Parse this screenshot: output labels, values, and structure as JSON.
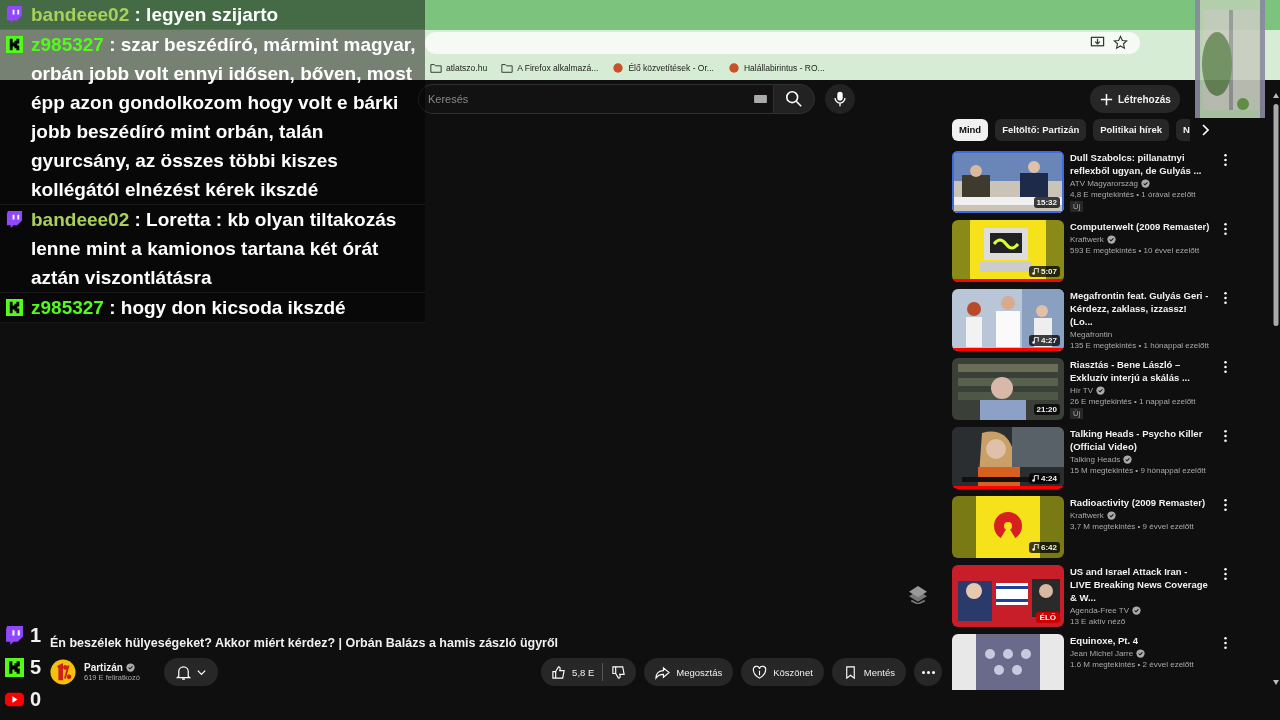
{
  "browser": {
    "bookmarks": [
      {
        "label": "atlatszo.hu",
        "kind": "folder"
      },
      {
        "label": "A Firefox alkalmazá...",
        "kind": "folder"
      },
      {
        "label": "Élő közvetítések - Or...",
        "kind": "site"
      },
      {
        "label": "Halállabirintus - RO...",
        "kind": "site"
      }
    ]
  },
  "topbar": {
    "search": {
      "placeholder": "Keresés"
    },
    "create_button": "Létrehozás"
  },
  "chips": [
    {
      "label": "Mind",
      "selected": true
    },
    {
      "label": "Feltöltő: Partizán",
      "selected": false
    },
    {
      "label": "Politikai hírek",
      "selected": false
    },
    {
      "label": "N",
      "selected": false
    }
  ],
  "video": {
    "title": "Én beszélek hülyeségeket? Akkor miért kérdez? | Orbán Balázs a hamis zászló ügyről",
    "channel": "Partizán",
    "verified": true,
    "subscribers": "619 E feliratkozó",
    "likes": "5,8 E",
    "share": "Megosztás",
    "thanks": "Köszönet",
    "save": "Mentés"
  },
  "recommendations": [
    {
      "title": "Dull Szabolcs: pillanatnyi reflexből ugyan, de Gulyás ...",
      "channel": "ATV Magyarország",
      "verified": true,
      "meta": "4,8 E megtekintés • 1 órával ezelőtt",
      "badge": "Új",
      "duration": "15:32",
      "music": false,
      "watched": false,
      "focused": true
    },
    {
      "title": "Computerwelt (2009 Remaster)",
      "channel": "Kraftwerk",
      "verified": true,
      "meta": "593 E megtekintés • 10 évvel ezelőtt",
      "duration": "5:07",
      "music": true,
      "watched": true,
      "focused": false
    },
    {
      "title": "Megafrontin feat. Gulyás Geri - Kérdezz, zaklass, izzassz! (Lo...",
      "channel": "Megafrontin",
      "verified": false,
      "meta": "135 E megtekintés • 1 hónappal ezelőtt",
      "duration": "4:27",
      "music": true,
      "watched": true,
      "focused": false
    },
    {
      "title": "Riasztás - Bene László – Exkluzív interjú a skálás ...",
      "channel": "Hír TV",
      "verified": true,
      "meta": "26 E megtekintés • 1 nappal ezelőtt",
      "badge": "Új",
      "duration": "21:20",
      "music": false,
      "watched": false,
      "focused": false
    },
    {
      "title": "Talking Heads - Psycho Killer (Official Video)",
      "channel": "Talking Heads",
      "verified": true,
      "meta": "15 M megtekintés • 9 hónappal ezelőtt",
      "duration": "4:24",
      "music": true,
      "watched": true,
      "focused": false
    },
    {
      "title": "Radioactivity (2009 Remaster)",
      "channel": "Kraftwerk",
      "verified": true,
      "meta": "3,7 M megtekintés • 9 évvel ezelőtt",
      "duration": "6:42",
      "music": true,
      "watched": false,
      "focused": false
    },
    {
      "title": "US and Israel Attack Iran - LIVE Breaking News Coverage & W...",
      "channel": "Agenda-Free TV",
      "verified": true,
      "meta": "13 E aktív néző",
      "live": "ÉLŐ",
      "watched": false,
      "focused": false
    },
    {
      "title": "Equinoxe, Pt. 4",
      "channel": "Jean Michel Jarre",
      "verified": true,
      "meta": "1.6 M megtekintés • 2 évvel ezelőtt",
      "focused": false
    }
  ],
  "chat": [
    {
      "kind": "twitch",
      "user": "bandeee02",
      "text": ": legyen szijarto"
    },
    {
      "kind": "kick",
      "user": "z985327",
      "text": ": szar beszédíró, mármint magyar, orbán jobb volt ennyi idősen, bőven, most épp azon gondolkozom hogy volt e bárki jobb beszédíró mint orbán, talán gyurcsány, az összes többi kiszes kollégától elnézést kérek ikszdé"
    },
    {
      "kind": "twitch",
      "user": "bandeee02",
      "text": ": Loretta : kb olyan tiltakozás lenne mint a kamionos tartana két órát aztán viszontlátásra"
    },
    {
      "kind": "kick",
      "user": "z985327",
      "text": ": hogy don kicsoda ikszdé"
    }
  ],
  "viewer_counts": [
    {
      "kind": "twitch",
      "count": "1"
    },
    {
      "kind": "kick",
      "count": "5"
    },
    {
      "kind": "youtube",
      "count": "0"
    }
  ]
}
